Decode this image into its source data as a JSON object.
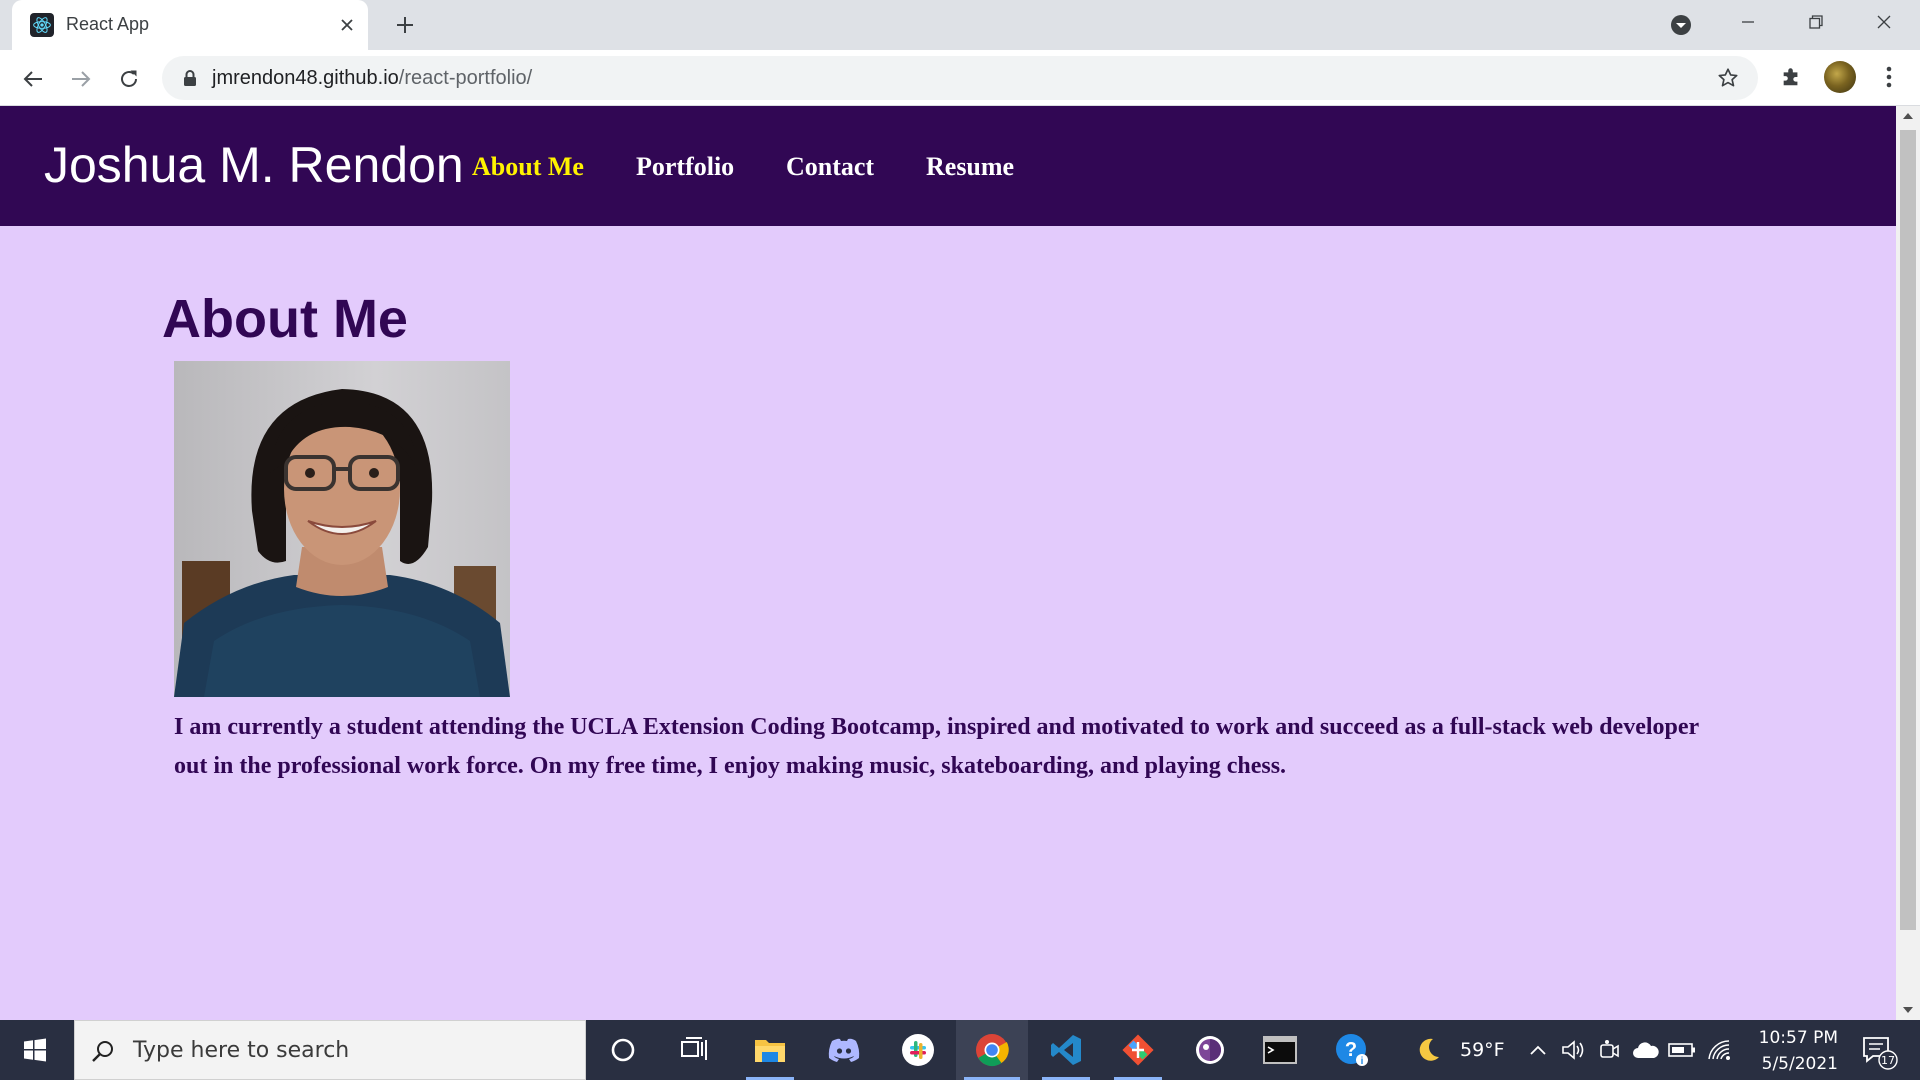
{
  "browser": {
    "tab": {
      "title": "React App",
      "favicon": "react-icon"
    },
    "url": {
      "host": "jmrendon48.github.io",
      "path": "/react-portfolio/"
    }
  },
  "site": {
    "brand": "Joshua M. Rendon",
    "nav": [
      {
        "label": "About Me",
        "active": true
      },
      {
        "label": "Portfolio",
        "active": false
      },
      {
        "label": "Contact",
        "active": false
      },
      {
        "label": "Resume",
        "active": false
      }
    ],
    "section_title": "About Me",
    "bio": "I am currently a student attending the UCLA Extension Coding Bootcamp, inspired and motivated to work and succeed as a full-stack web developer out in the professional work force. On my free time, I enjoy making music, skateboarding, and playing chess.",
    "colors": {
      "header_bg": "#310754",
      "page_bg": "#e3cbfc",
      "active_nav": "#fff200",
      "text": "#310754"
    }
  },
  "taskbar": {
    "search_placeholder": "Type here to search",
    "weather": {
      "icon": "moon-icon",
      "temp": "59°F"
    },
    "clock": {
      "time": "10:57 PM",
      "date": "5/5/2021"
    },
    "notification_count": "17",
    "apps": [
      "cortana-icon",
      "task-view-icon",
      "file-explorer-icon",
      "discord-icon",
      "slack-icon",
      "chrome-icon",
      "vscode-icon",
      "git-icon",
      "tor-icon",
      "terminal-icon",
      "help-icon"
    ]
  }
}
